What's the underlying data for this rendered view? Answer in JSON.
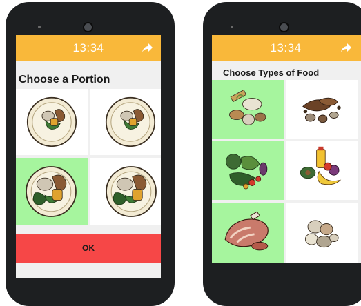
{
  "left_screen": {
    "status": {
      "time": "13:34",
      "share_icon": "share-arrow-icon"
    },
    "title": "Choose a Portion",
    "portions": [
      {
        "icon": "small-portion-plate",
        "selected": false
      },
      {
        "icon": "small-portion-plate",
        "selected": false
      },
      {
        "icon": "large-portion-plate",
        "selected": true
      },
      {
        "icon": "large-portion-plate",
        "selected": false
      }
    ],
    "ok_label": "OK"
  },
  "right_screen": {
    "status": {
      "time": "13:34",
      "share_icon": "share-arrow-icon"
    },
    "title": "Choose Types of Food",
    "foods": [
      {
        "icon": "grains-and-tubers-icon",
        "selected": true
      },
      {
        "icon": "legumes-and-nuts-icon",
        "selected": false
      },
      {
        "icon": "vegetables-icon",
        "selected": true
      },
      {
        "icon": "fruits-and-oils-icon",
        "selected": false
      },
      {
        "icon": "meat-icon",
        "selected": true
      },
      {
        "icon": "eggs-icon",
        "selected": false
      }
    ]
  },
  "colors": {
    "status_bar": "#f9b83a",
    "selected_cell": "#a6f59e",
    "ok_button": "#f64747",
    "phone_body": "#1d1f21"
  }
}
